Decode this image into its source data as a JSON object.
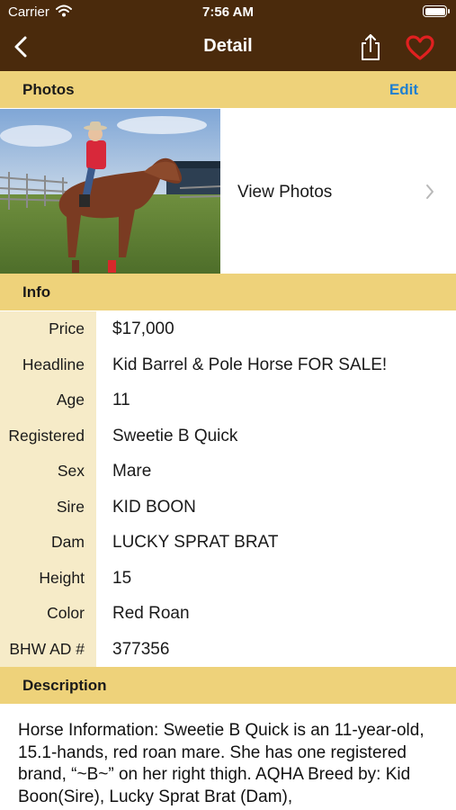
{
  "status_bar": {
    "carrier": "Carrier",
    "time": "7:56 AM"
  },
  "nav": {
    "title": "Detail"
  },
  "photos": {
    "header": "Photos",
    "edit_label": "Edit",
    "view_label": "View Photos"
  },
  "info": {
    "header": "Info",
    "rows": [
      {
        "label": "Price",
        "value": "$17,000"
      },
      {
        "label": "Headline",
        "value": "Kid Barrel & Pole Horse FOR SALE!"
      },
      {
        "label": "Age",
        "value": "11"
      },
      {
        "label": "Registered",
        "value": "Sweetie B Quick"
      },
      {
        "label": "Sex",
        "value": "Mare"
      },
      {
        "label": "Sire",
        "value": "KID BOON"
      },
      {
        "label": "Dam",
        "value": "LUCKY SPRAT BRAT"
      },
      {
        "label": "Height",
        "value": "15"
      },
      {
        "label": "Color",
        "value": "Red Roan"
      },
      {
        "label": "BHW AD #",
        "value": "377356"
      }
    ]
  },
  "description": {
    "header": "Description",
    "text": "Horse Information: Sweetie B Quick is an 11-year-old, 15.1-hands, red roan mare. She has one registered brand, “~B~” on her right thigh. AQHA Breed by: Kid Boon(Sire), Lucky Sprat Brat (Dam),"
  },
  "colors": {
    "nav_bg": "#4a2a0c",
    "section_bg": "#eed27a",
    "label_col_bg": "#f6ebc8",
    "accent": "#1f7fd0",
    "heart": "#e02020"
  },
  "icons": {
    "back": "chevron-left-icon",
    "share": "share-icon",
    "favorite": "heart-icon",
    "wifi": "wifi-icon",
    "battery": "battery-icon",
    "disclosure": "chevron-right-icon"
  }
}
